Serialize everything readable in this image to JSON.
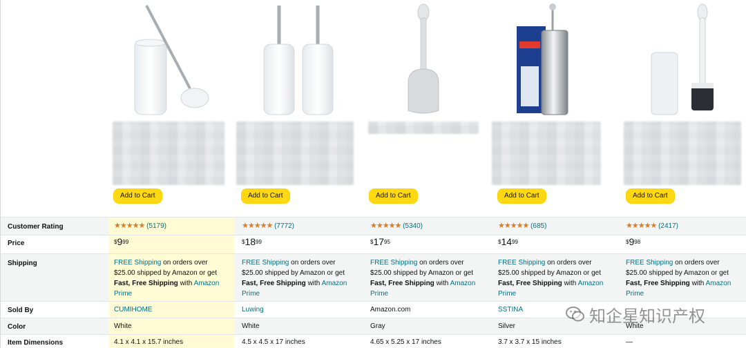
{
  "products": [
    {
      "add_to_cart": "Add to Cart",
      "rating_count": "(5179)",
      "price_symbol": "$",
      "price_whole": "9",
      "price_fraction": "99",
      "sold_by": "CUMIHOME",
      "color": "White",
      "dimensions": "4.1 x 4.1 x 15.7 inches",
      "image_icon": "toilet-brush-white-holder"
    },
    {
      "add_to_cart": "Add to Cart",
      "rating_count": "(7772)",
      "price_symbol": "$",
      "price_whole": "18",
      "price_fraction": "99",
      "sold_by": "Luwing",
      "color": "White",
      "dimensions": "4.5 x 4.5 x 17 inches",
      "image_icon": "toilet-brush-double-set"
    },
    {
      "add_to_cart": "Add to Cart",
      "rating_count": "(5340)",
      "price_symbol": "$",
      "price_whole": "17",
      "price_fraction": "95",
      "sold_by": "Amazon.com",
      "color": "Gray",
      "dimensions": "4.65 x 5.25 x 17 inches",
      "image_icon": "toilet-plunger-gray"
    },
    {
      "add_to_cart": "Add to Cart",
      "rating_count": "(685)",
      "price_symbol": "$",
      "price_whole": "14",
      "price_fraction": "99",
      "sold_by": "SSTINA",
      "color": "Silver",
      "dimensions": "3.7 x 3.7 x 15 inches",
      "image_icon": "toilet-brush-stainless-box"
    },
    {
      "add_to_cart": "Add to Cart",
      "rating_count": "(2417)",
      "price_symbol": "$",
      "price_whole": "9",
      "price_fraction": "98",
      "sold_by": "",
      "color": "White",
      "dimensions": "—",
      "image_icon": "toilet-brush-white-round"
    }
  ],
  "rows": {
    "rating_label": "Customer Rating",
    "price_label": "Price",
    "shipping_label": "Shipping",
    "sold_by_label": "Sold By",
    "color_label": "Color",
    "dimensions_label": "Item Dimensions"
  },
  "shipping": {
    "free_shipping": "FREE Shipping",
    "line1_rest": " on orders over",
    "line2": "$25.00 shipped by Amazon or get",
    "fast_free": "Fast, Free Shipping",
    "with": " with ",
    "amazon": "Amazon",
    "prime": "Prime"
  },
  "stars": "★★★★★",
  "watermark": "知企星知识产权",
  "colors": {
    "button": "#ffd814",
    "link": "#007185",
    "star": "#de7921",
    "highlight": "#fefbd5"
  }
}
